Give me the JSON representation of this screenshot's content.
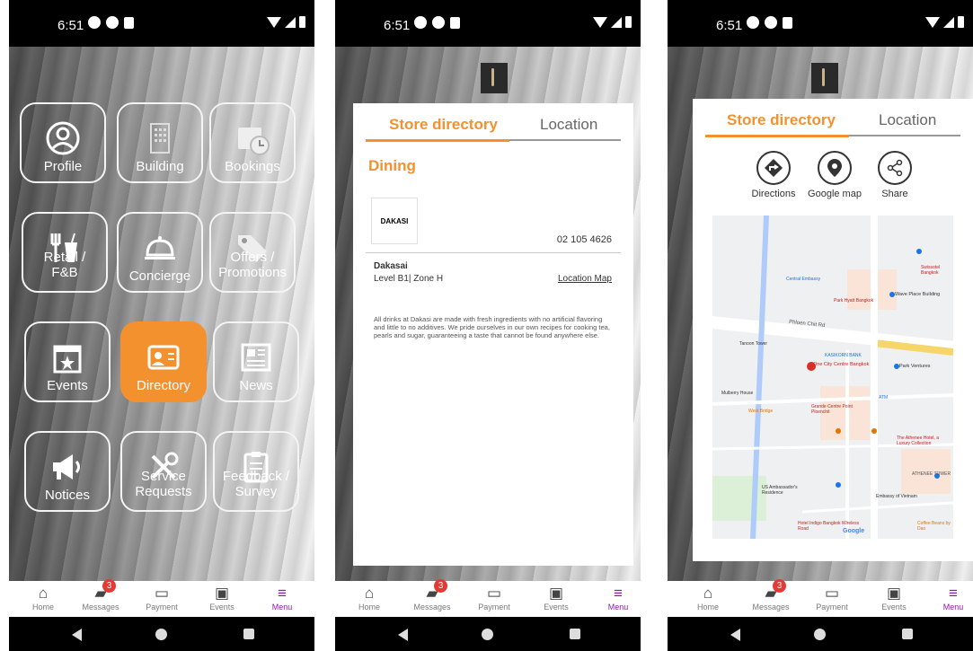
{
  "status": {
    "time": "6:51"
  },
  "menu_grid": {
    "profile": "Profile",
    "building": "Building",
    "bookings": "Bookings",
    "retail_line1": "Retail /",
    "retail_line2": "F&B",
    "concierge": "Concierge",
    "offers_line1": "Offers /",
    "offers_line2": "Promotions",
    "events": "Events",
    "directory": "Directory",
    "news": "News",
    "notices": "Notices",
    "service_line1": "Service",
    "service_line2": "Requests",
    "feedback_line1": "Feedback /",
    "feedback_line2": "Survey"
  },
  "tabs": {
    "store_directory": "Store directory",
    "location": "Location"
  },
  "directory": {
    "section": "Dining",
    "store_logo_text": "DAKASI",
    "phone": "02 105 4626",
    "store_name": "Dakasai",
    "store_location": "Level B1| Zone H",
    "location_map_link": "Location Map",
    "description": "All drinks at Dakasi are made with fresh ingredients with no artificial flavoring and little to no additives. We pride ourselves in our own recipes for cooking tea, pearls and sugar, guaranteeing a taste that cannot be found anywhere else."
  },
  "location_actions": {
    "directions": "Directions",
    "google_map": "Google map",
    "share": "Share"
  },
  "map_labels": {
    "road_main": "Phloen Chit Rd",
    "place_one_city": "One City Centre Bangkok",
    "place_park_ventures": "Park Ventures",
    "place_wave": "Wave Place Building",
    "place_grande": "Grande Centre Point Ploenchit",
    "place_athenee": "The Athenee Hotel, a Luxury Collection",
    "place_embassy_vn": "Embassy of Vietnam",
    "place_central": "Central Embassy",
    "place_park_hyatt": "Park Hyatt Bangkok",
    "place_swissotel": "Swissotel Bangkok",
    "place_us_residence": "US Ambassador's Residence",
    "place_hotel_indigo": "Hotel Indigo Bangkok Wireless Road",
    "place_kasikorn": "KASIKORN BANK",
    "place_athenee_tower": "ATHENEE TOWER",
    "place_mulberry": "Mulberry House",
    "place_west_bridge": "West Bridge",
    "place_tanoon": "Tanoon Tower",
    "place_coffee": "Coffee Beans by Dao",
    "place_atm": "ATM",
    "google_logo": "Google"
  },
  "navbar": {
    "home": "Home",
    "messages": "Messages",
    "messages_badge": "3",
    "payment": "Payment",
    "events": "Events",
    "menu": "Menu"
  },
  "colors": {
    "accent": "#f4912f",
    "menu_active": "#8a1cab",
    "badge": "#e53935"
  },
  "icons": {
    "home": "home-icon",
    "messages": "chat-icon",
    "payment": "card-clock-icon",
    "events": "calendar-icon",
    "menu": "hamburger-icon"
  }
}
